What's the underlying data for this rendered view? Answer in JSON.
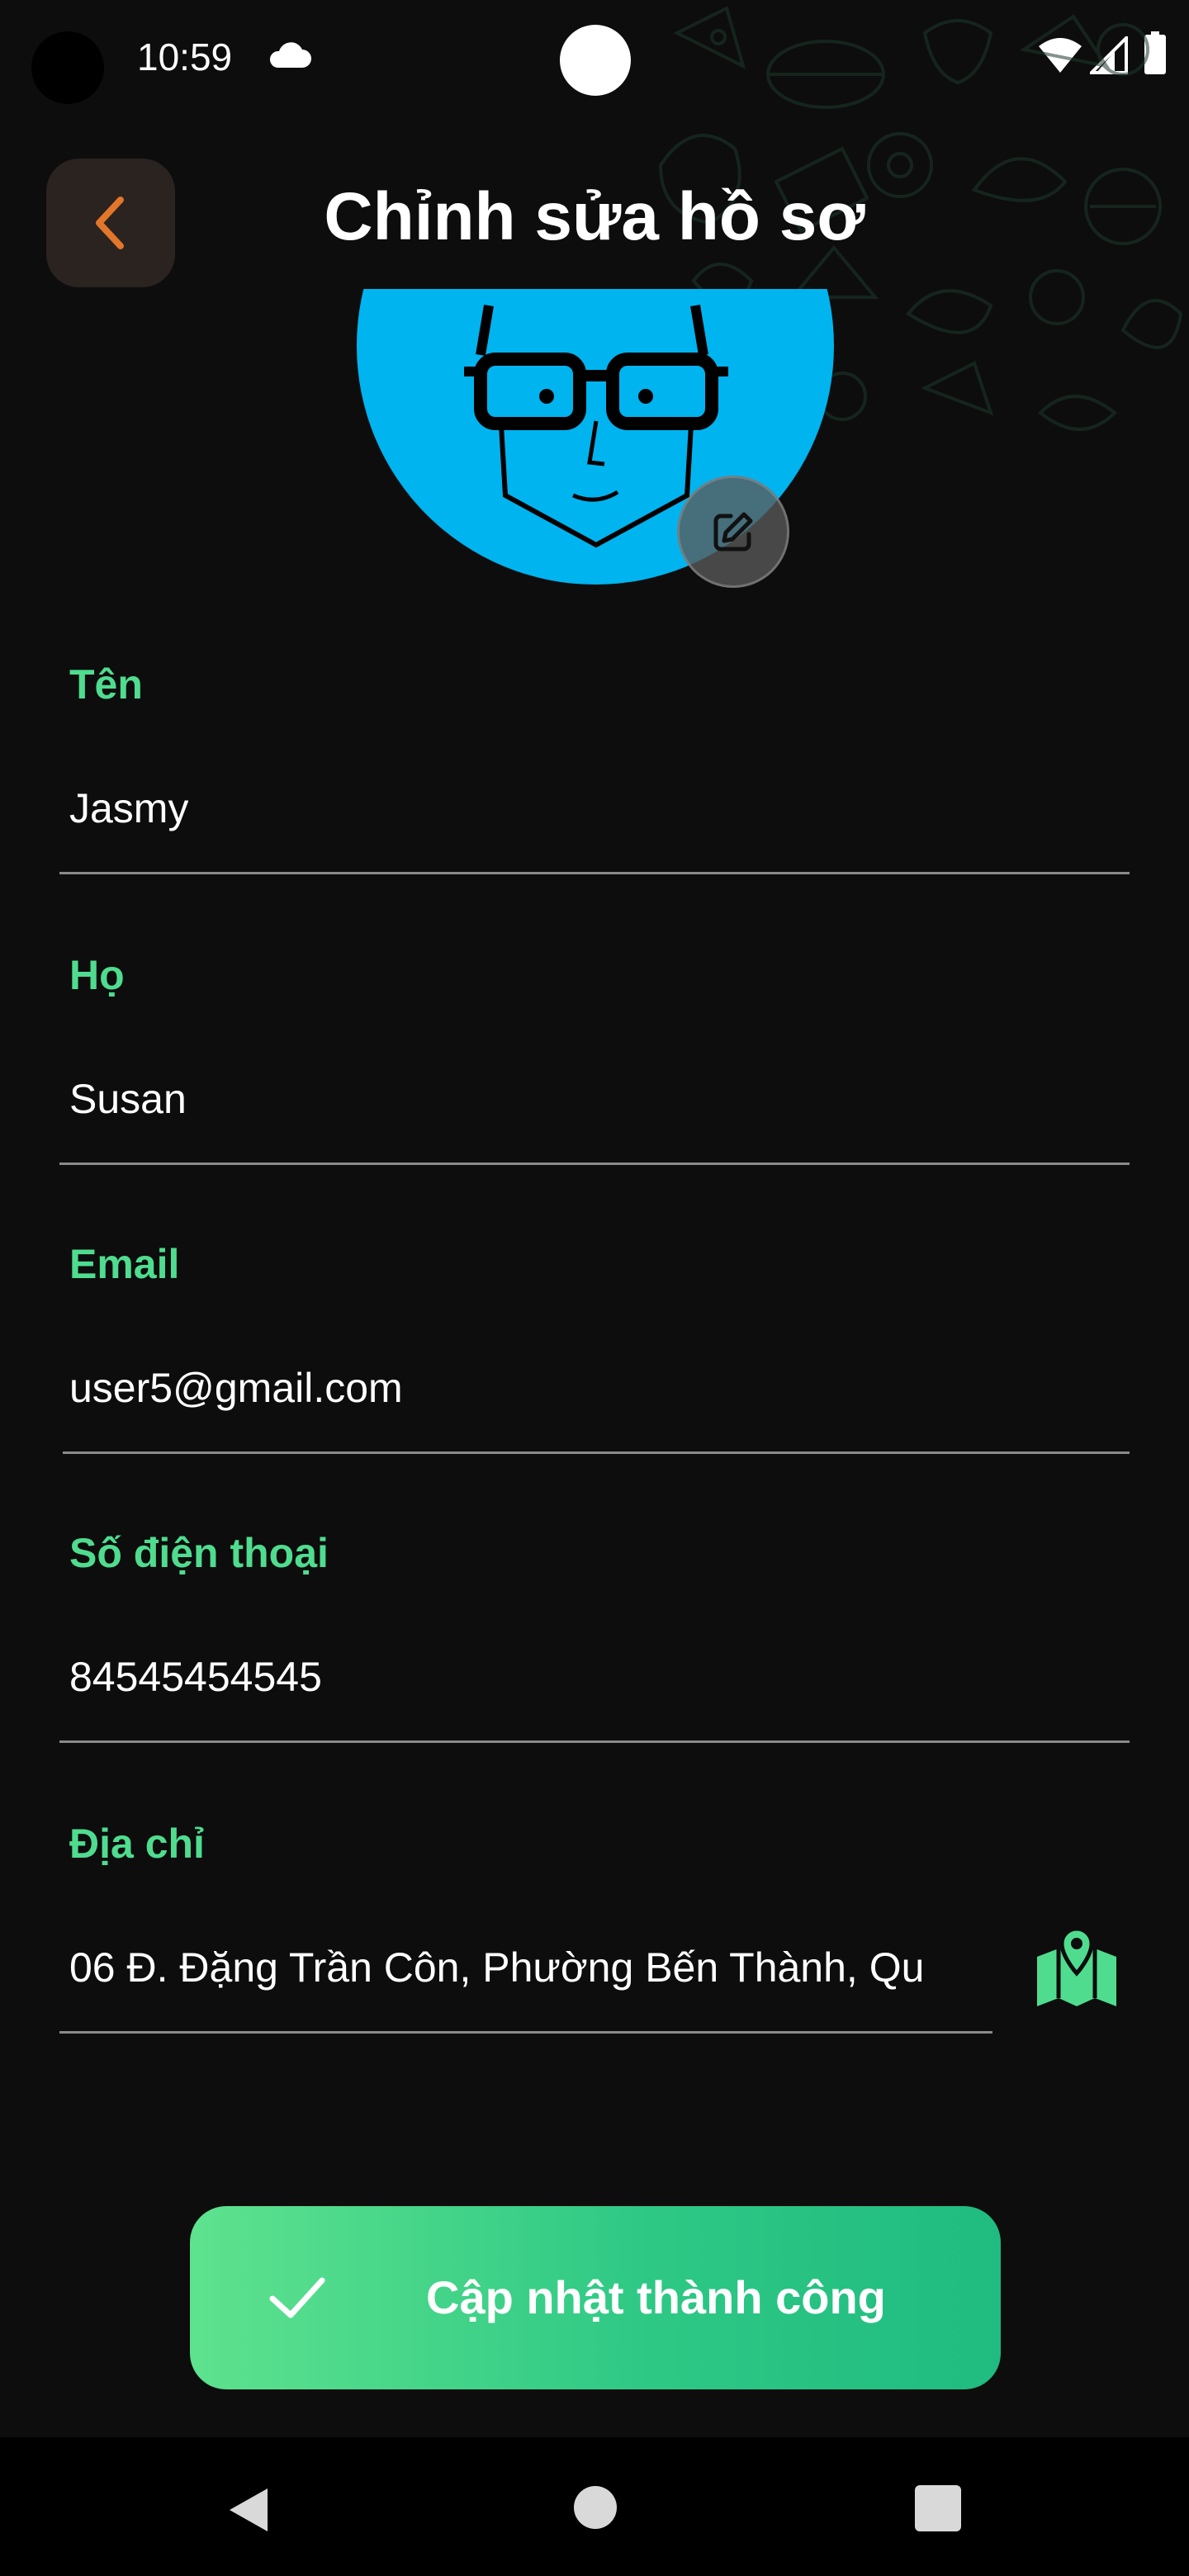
{
  "status_bar": {
    "time": "10:59",
    "icons": [
      "cloud-icon",
      "wifi-icon",
      "signal-icon",
      "battery-icon"
    ]
  },
  "header": {
    "title": "Chỉnh sửa hồ sơ",
    "back_icon": "chevron-left-icon"
  },
  "avatar": {
    "edit_icon": "edit-icon"
  },
  "form": {
    "first_name": {
      "label": "Tên",
      "value": "Jasmy"
    },
    "last_name": {
      "label": "Họ",
      "value": "Susan"
    },
    "email": {
      "label": "Email",
      "value": "user5@gmail.com"
    },
    "phone": {
      "label": "Số điện thoại",
      "value": "84545454545"
    },
    "address": {
      "label": "Địa chỉ",
      "value": "06 Đ. Đặng Trần Côn, Phường Bến Thành, Qu",
      "icon": "map-pin-icon"
    }
  },
  "toast": {
    "icon": "check-icon",
    "message": "Cập nhật thành công"
  },
  "nav_bar": {
    "icons": [
      "nav-back-icon",
      "nav-home-icon",
      "nav-recents-icon"
    ]
  },
  "colors": {
    "background": "#0d0d0d",
    "accent_green": "#4fdc8f",
    "back_arrow_orange": "#e2762a",
    "avatar_blue": "#00b4f0"
  }
}
